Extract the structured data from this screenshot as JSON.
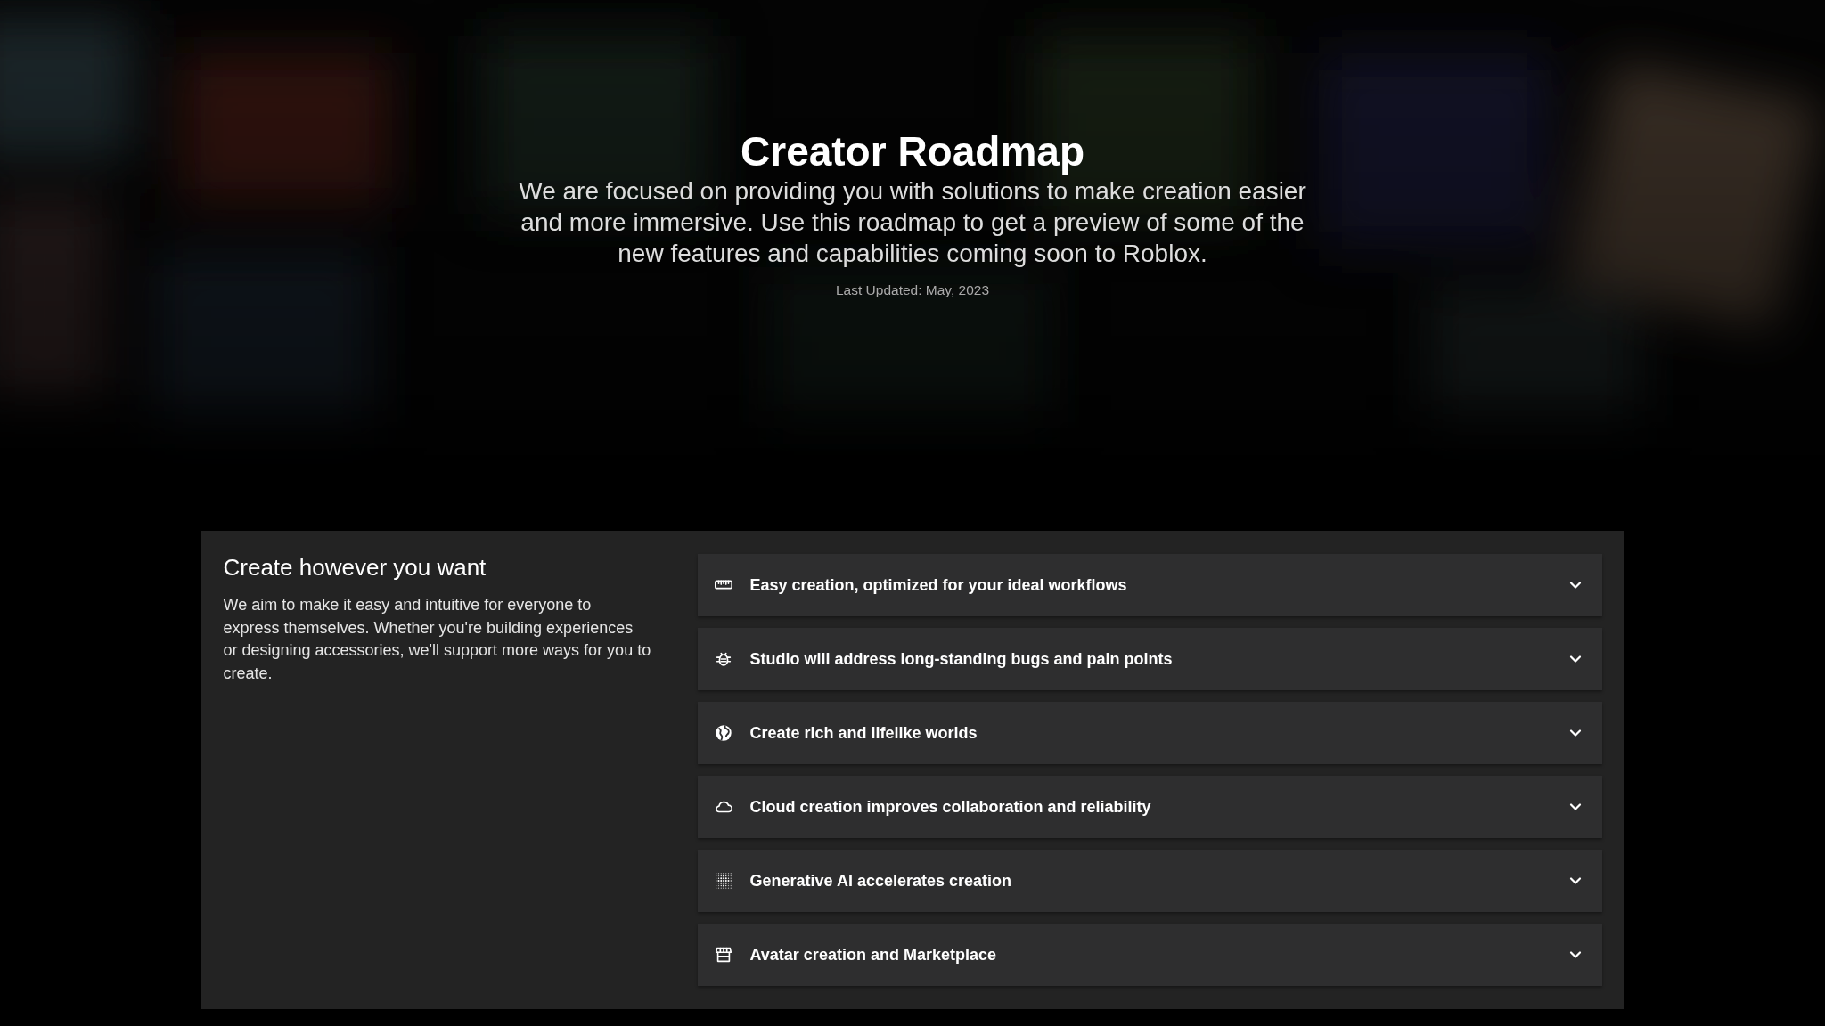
{
  "hero": {
    "kind": "picture",
    "title": "Creator Roadmap",
    "subtitle": "We are focused on providing you with solutions to make creation easier and more immersive. Use this roadmap to get a preview of some of the new features and capabilities coming soon to Roblox.",
    "updated": "Last Updated: May, 2023"
  },
  "section": {
    "heading": "Create however you want",
    "description": "We aim to make it easy and intuitive for everyone to express themselves. Whether you're building experiences or designing accessories, we'll support more ways for you to create.",
    "items": [
      {
        "label": "Easy creation, optimized for your ideal workflows",
        "expanded": false
      },
      {
        "label": "Studio will address long-standing bugs and pain points",
        "expanded": false
      },
      {
        "label": "Create rich and lifelike worlds",
        "expanded": false
      },
      {
        "label": "Cloud creation improves collaboration and reliability",
        "expanded": false
      },
      {
        "label": "Generative AI accelerates creation",
        "expanded": false
      },
      {
        "label": "Avatar creation and Marketplace",
        "expanded": false
      }
    ]
  }
}
